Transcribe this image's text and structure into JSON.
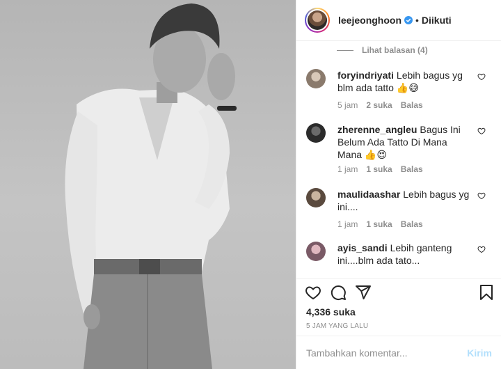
{
  "post": {
    "username": "leejeonghoon",
    "follow_status": "Diikuti",
    "separator": "•"
  },
  "comments": {
    "view_replies": "Lihat balasan (4)",
    "items": [
      {
        "user": "foryindriyati",
        "text": "Lebih bagus yg blm ada tatto 👍😅",
        "time": "5 jam",
        "likes": "2 suka",
        "reply": "Balas"
      },
      {
        "user": "zherenne_angleu",
        "text": "Bagus Ini Belum Ada Tatto Di Mana Mana 👍😍",
        "time": "1 jam",
        "likes": "1 suka",
        "reply": "Balas"
      },
      {
        "user": "maulidaashar",
        "text": "Lebih bagus yg ini....",
        "time": "1 jam",
        "likes": "1 suka",
        "reply": "Balas"
      },
      {
        "user": "ayis_sandi",
        "text": "Lebih ganteng ini....blm ada tato...",
        "time": "",
        "likes": "",
        "reply": ""
      }
    ]
  },
  "stats": {
    "likes": "4,336 suka",
    "posted": "5 JAM YANG LALU"
  },
  "composer": {
    "placeholder": "Tambahkan komentar...",
    "send_label": "Kirim"
  },
  "icons": {
    "like": "heart-icon",
    "comment": "comment-icon",
    "share": "paper-plane-icon",
    "save": "bookmark-icon",
    "verified": "verified-badge-icon"
  },
  "colors": {
    "verified": "#3897f0",
    "send_disabled": "#b2dffc",
    "muted": "#8e8e8e"
  }
}
